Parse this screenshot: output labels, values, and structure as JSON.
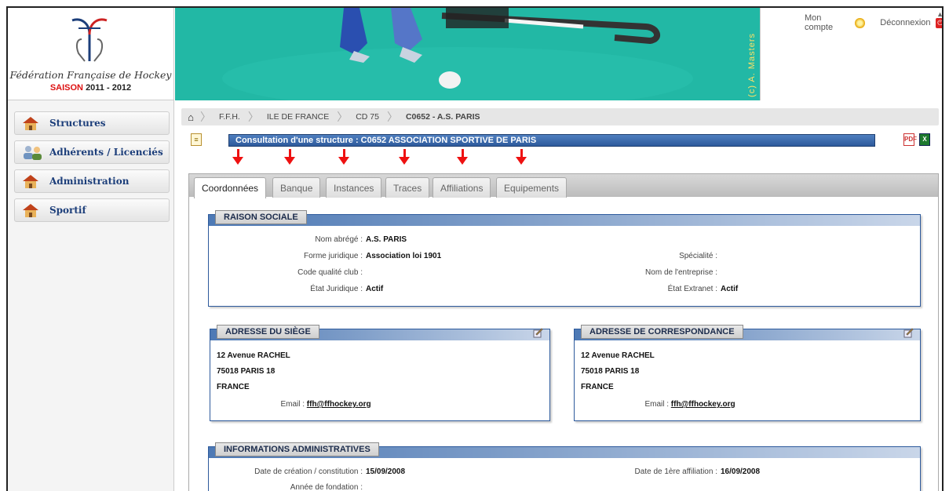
{
  "brand": {
    "name": "Fédération Française de Hockey",
    "season_label": "SAISON",
    "season_value": "2011 - 2012"
  },
  "banner": {
    "credit": "(c) A. Masters"
  },
  "account": {
    "my_account": "Mon compte",
    "logout": "Déconnexion"
  },
  "sidebar": {
    "items": [
      {
        "label": "Structures"
      },
      {
        "label": "Adhérents / Licenciés"
      },
      {
        "label": "Administration"
      },
      {
        "label": "Sportif"
      }
    ]
  },
  "breadcrumb": {
    "items": [
      "F.F.H.",
      "ILE DE FRANCE",
      "CD 75"
    ],
    "current": "C0652 - A.S. PARIS"
  },
  "page": {
    "title": "Consultation d'une structure : C0652 ASSOCIATION SPORTIVE DE PARIS"
  },
  "tabs": [
    {
      "label": "Coordonnées",
      "active": true
    },
    {
      "label": "Banque"
    },
    {
      "label": "Instances"
    },
    {
      "label": "Traces"
    },
    {
      "label": "Affiliations"
    },
    {
      "label": "Equipements"
    }
  ],
  "raison_sociale": {
    "title": "RAISON SOCIALE",
    "nom_abrege_label": "Nom abrégé :",
    "nom_abrege": "A.S. PARIS",
    "forme_juridique_label": "Forme juridique :",
    "forme_juridique": "Association loi 1901",
    "code_qualite_label": "Code qualité club :",
    "etat_juridique_label": "État Juridique :",
    "etat_juridique": "Actif",
    "specialite_label": "Spécialité :",
    "nom_entreprise_label": "Nom de l'entreprise :",
    "etat_extranet_label": "État Extranet :",
    "etat_extranet": "Actif"
  },
  "adresse_siege": {
    "title": "ADRESSE DU SIÈGE",
    "line1": "12 Avenue RACHEL",
    "line2": "75018 PARIS 18",
    "line3": "FRANCE",
    "email_label": "Email :",
    "email": "ffh@ffhockey.org"
  },
  "adresse_correspondance": {
    "title": "ADRESSE DE CORRESPONDANCE",
    "line1": "12 Avenue RACHEL",
    "line2": "75018 PARIS 18",
    "line3": "FRANCE",
    "email_label": "Email :",
    "email": "ffh@ffhockey.org"
  },
  "infos_admin": {
    "title": "INFORMATIONS ADMINISTRATIVES",
    "date_creation_label": "Date de création / constitution :",
    "date_creation": "15/09/2008",
    "annee_fondation_label": "Année de fondation :",
    "date_affiliation_label": "Date de 1ère affiliation :",
    "date_affiliation": "16/09/2008"
  },
  "colors": {
    "accent": "#2d5a9c",
    "arrow": "#e11111",
    "banner": "#1fb6a2"
  }
}
